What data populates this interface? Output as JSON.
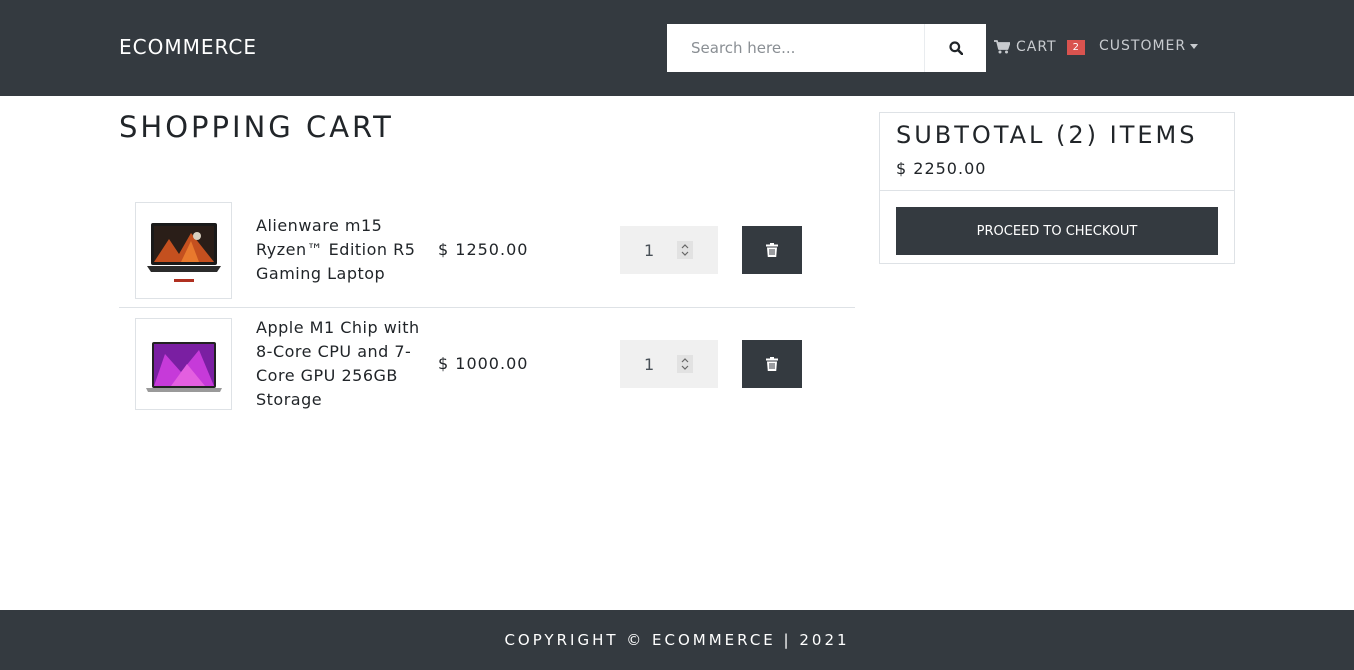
{
  "navbar": {
    "brand": "ECOMMERCE",
    "search": {
      "placeholder": "Search here...",
      "value": "",
      "button_icon": "search-icon"
    },
    "cart": {
      "label": "CART",
      "count": "2",
      "icon": "shopping-cart-icon",
      "badge_color": "#d9534f"
    },
    "user_menu": {
      "label": "CUSTOMER",
      "icon": "caret-down-icon"
    }
  },
  "main": {
    "title": "SHOPPING CART",
    "items": [
      {
        "name": "Alienware m15 Ryzen™ Edition R5 Gaming Laptop",
        "price": "$ 1250.00",
        "quantity": "1",
        "image": "gaming-laptop-thumbnail",
        "delete_icon": "trash-icon"
      },
      {
        "name": "Apple M1 Chip with 8-Core CPU and 7-Core GPU 256GB Storage",
        "price": "$ 1000.00",
        "quantity": "1",
        "image": "macbook-thumbnail",
        "delete_icon": "trash-icon"
      }
    ]
  },
  "summary": {
    "title": "SUBTOTAL (2) ITEMS",
    "total": "$ 2250.00",
    "checkout_label": "PROCEED TO CHECKOUT"
  },
  "footer": {
    "text": "COPYRIGHT © ECOMMERCE | 2021"
  },
  "colors": {
    "dark": "#343a40",
    "badge": "#d9534f",
    "border": "#dee2e6"
  }
}
